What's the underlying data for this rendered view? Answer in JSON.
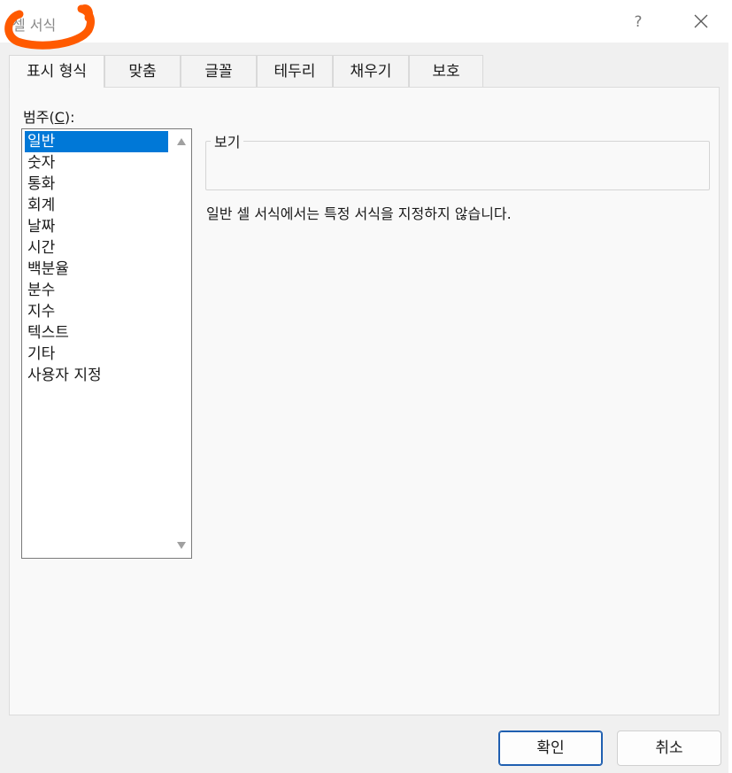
{
  "window": {
    "title": "셀 서식",
    "help_label": "?",
    "annotation_color": "#ff5a00"
  },
  "tabs": [
    {
      "label": "표시 형식",
      "active": true
    },
    {
      "label": "맞춤",
      "active": false
    },
    {
      "label": "글꼴",
      "active": false
    },
    {
      "label": "테두리",
      "active": false
    },
    {
      "label": "채우기",
      "active": false
    },
    {
      "label": "보호",
      "active": false
    }
  ],
  "category": {
    "label_prefix": "범주(",
    "label_accel": "C",
    "label_suffix": "):",
    "selected": "일반",
    "items": [
      "일반",
      "숫자",
      "통화",
      "회계",
      "날짜",
      "시간",
      "백분율",
      "분수",
      "지수",
      "텍스트",
      "기타",
      "사용자 지정"
    ]
  },
  "preview": {
    "legend": "보기",
    "sample": ""
  },
  "description": "일반 셀 서식에서는 특정 서식을 지정하지 않습니다.",
  "buttons": {
    "ok": "확인",
    "cancel": "취소"
  },
  "colors": {
    "selection": "#0078d7",
    "primary_border": "#1f5fb0"
  }
}
